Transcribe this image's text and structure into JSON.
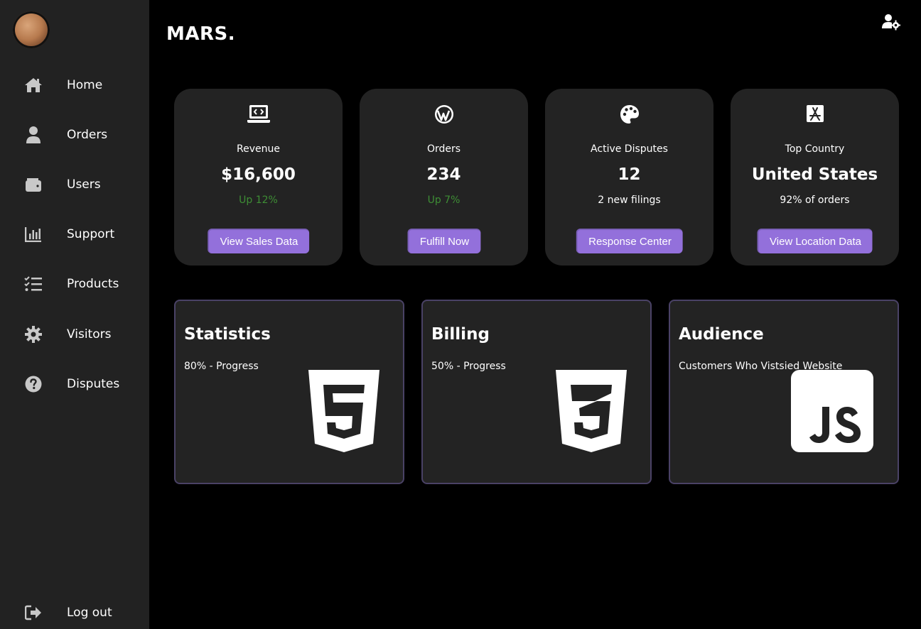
{
  "brand": "MARS.",
  "sidebar": {
    "items": [
      {
        "label": "Home",
        "icon": "home-icon"
      },
      {
        "label": "Orders",
        "icon": "user-icon"
      },
      {
        "label": "Users",
        "icon": "wallet-icon"
      },
      {
        "label": "Support",
        "icon": "chart-icon"
      },
      {
        "label": "Products",
        "icon": "list-check-icon"
      },
      {
        "label": "Visitors",
        "icon": "gear-icon"
      },
      {
        "label": "Disputes",
        "icon": "question-icon"
      }
    ],
    "logout": {
      "label": "Log out",
      "icon": "logout-icon"
    }
  },
  "stats": [
    {
      "title": "Revenue",
      "value": "$16,600",
      "sub": "Up 12%",
      "button": "View Sales Data",
      "icon": "laptop-code-icon"
    },
    {
      "title": "Orders",
      "value": "234",
      "sub": "Up 7%",
      "button": "Fulfill Now",
      "icon": "wordpress-icon"
    },
    {
      "title": "Active Disputes",
      "value": "12",
      "sub": "2 new filings",
      "button": "Response Center",
      "icon": "palette-icon"
    },
    {
      "title": "Top Country",
      "value": "United States",
      "sub": "92% of orders",
      "button": "View Location Data",
      "icon": "app-store-icon"
    }
  ],
  "cards": [
    {
      "title": "Statistics",
      "sub": "80% - Progress",
      "icon": "html5-icon",
      "progress": 0.8
    },
    {
      "title": "Billing",
      "sub": "50% - Progress",
      "icon": "css3-icon",
      "progress": 0.5
    },
    {
      "title": "Audience",
      "sub": "Customers Who Vistsied Website",
      "icon": "js-icon"
    }
  ],
  "colors": {
    "accent": "#9370db",
    "positive": "#3e8e35",
    "card": "#232323",
    "sidebar": "#222222"
  }
}
